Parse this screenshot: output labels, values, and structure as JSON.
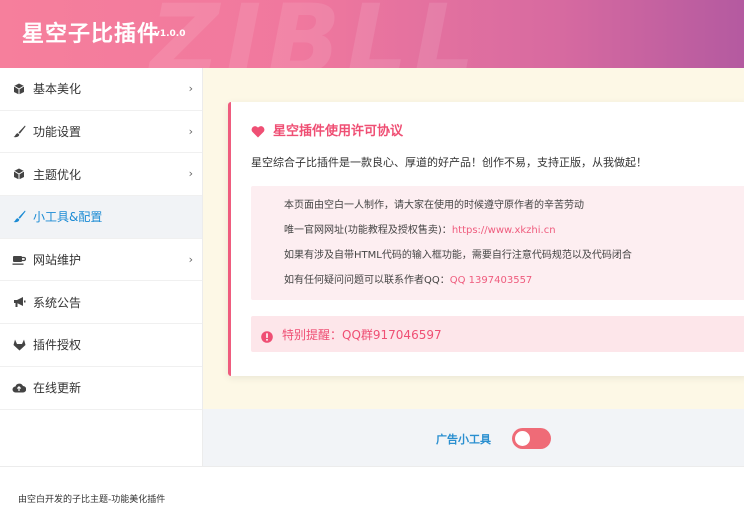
{
  "header": {
    "title": "星空子比插件",
    "version": "v1.0.0"
  },
  "sidebar": {
    "items": [
      {
        "label": "基本美化",
        "icon": "cube-icon"
      },
      {
        "label": "功能设置",
        "icon": "paintbrush-icon"
      },
      {
        "label": "主题优化",
        "icon": "cube-icon"
      },
      {
        "label": "小工具&配置",
        "icon": "paintbrush-icon",
        "active": true
      },
      {
        "label": "网站维护",
        "icon": "coffee-cup-icon"
      },
      {
        "label": "系统公告",
        "icon": "megaphone-icon"
      },
      {
        "label": "插件授权",
        "icon": "gitlab-fox-icon"
      },
      {
        "label": "在线更新",
        "icon": "cloud-upload-icon"
      }
    ]
  },
  "notice": {
    "title": "星空插件使用许可协议",
    "intro": "星空综合子比插件是一款良心、厚道的好产品！创作不易，支持正版，从我做起！",
    "lines": {
      "l1": "本页面由空白一人制作，请大家在使用的时候遵守原作者的辛苦劳动",
      "l2_prefix": "唯一官网网址(功能教程及授权售卖)：",
      "l2_link": "https://www.xkzhi.cn",
      "l3": "如果有涉及自带HTML代码的输入框功能，需要自行注意代码规范以及代码闭合",
      "l4_prefix": "如有任何疑问问题可以联系作者QQ：",
      "l4_link": "QQ 1397403557"
    },
    "alert": "特别提醒：QQ群917046597"
  },
  "toggle": {
    "label": "广告小工具",
    "state": "on"
  },
  "footer": {
    "text": "由空白开发的子比主题-功能美化插件"
  },
  "colors": {
    "accent_pink": "#ef5c7e",
    "accent_blue": "#1b8bd4",
    "content_bg": "#fdf8e6"
  }
}
